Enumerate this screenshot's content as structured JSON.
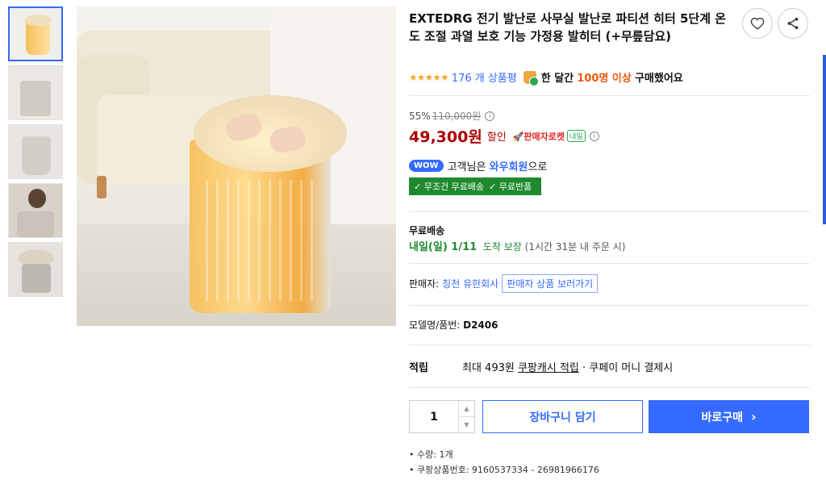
{
  "thumbnails": [
    {
      "name": "thumb-heater-lit",
      "active": true
    },
    {
      "name": "thumb-heater-room",
      "active": false
    },
    {
      "name": "thumb-heater-open",
      "active": false
    },
    {
      "name": "thumb-heater-person",
      "active": false
    },
    {
      "name": "thumb-heater-blanket",
      "active": false
    }
  ],
  "product": {
    "title": "EXTEDRG 전기 발난로 사무실 발난로 파티션 히터 5단계 온도 조절 과열 보호 기능 가정용 발히터 (+무릎담요)",
    "rating_stars": "★★★★★",
    "review_count": "176 개 상품평",
    "purchase_prefix": "한 달간",
    "purchase_count": "100명 이상",
    "purchase_suffix": "구매했어요"
  },
  "price": {
    "discount_rate": "55%",
    "original": "110,000원",
    "sale": "49,300원",
    "sale_label": "할인",
    "rocket_label": "🚀판매자로켓",
    "tomorrow_badge": "내일",
    "info_icon": "i"
  },
  "wow": {
    "badge": "WOW",
    "text_prefix": "고객님은",
    "text_strong": "와우회원",
    "text_suffix": "으로",
    "free_shipping": "✓ 무조건 무료배송",
    "free_return": "✓ 무료반품"
  },
  "shipping": {
    "label": "무료배송",
    "date_strong": "내일(일)  1/11",
    "date_suffix": "도착 보장",
    "deadline": "(1시간 31분 내 주문 시)"
  },
  "seller": {
    "label": "판매자:",
    "name": "칭천 유한회사",
    "button": "판매자 상품 보러가기"
  },
  "model": {
    "label": "모델명/품번:",
    "value": "D2406"
  },
  "points": {
    "label": "적립",
    "max": "최대 493원",
    "cash": "쿠팡캐시 적립",
    "suffix": "· 쿠페이 머니 결제시"
  },
  "purchase": {
    "quantity": "1",
    "up_arrow": "▲",
    "down_arrow": "▼",
    "cart_button": "장바구니 담기",
    "buy_button": "바로구매",
    "buy_chevron": "›"
  },
  "details": {
    "quantity_line": "수량: 1개",
    "product_number": "쿠팡상품번호: 9160537334 - 26981966176"
  },
  "icons": {
    "heart": "heart-icon",
    "share": "share-icon"
  },
  "colors": {
    "accent": "#346aff",
    "price": "#ae0000",
    "green": "#1e8a2e",
    "star": "#f5a623"
  }
}
